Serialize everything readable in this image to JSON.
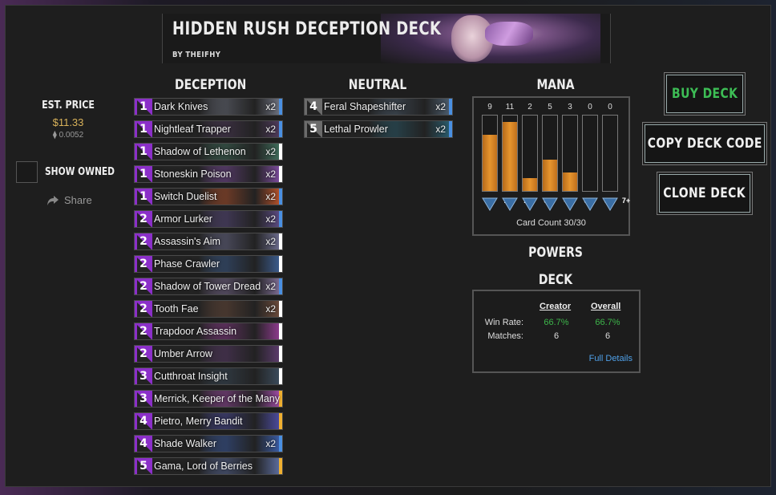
{
  "deck": {
    "title": "HIDDEN RUSH DECEPTION DECK",
    "author": "BY THEIFHY"
  },
  "columns": {
    "deception": "DECEPTION",
    "neutral": "NEUTRAL",
    "mana": "MANA",
    "powers": "POWERS",
    "deck_stats": "DECK STATS"
  },
  "price": {
    "label": "EST. PRICE",
    "usd": "$11.33",
    "eth": "⧫ 0.0052"
  },
  "owned": {
    "label": "SHOW OWNED"
  },
  "share": {
    "label": "Share"
  },
  "colors": {
    "deception_gem": "#8b2fc9",
    "neutral_gem": "#6b6b6b",
    "common_stripe": "#ffffff",
    "rare_stripe": "#4a90e2",
    "legendary_stripe": "#f0b030",
    "buy_text": "#3dbd55"
  },
  "deception_cards": [
    {
      "cost": "1",
      "name": "Dark Knives",
      "qty": "x2",
      "rarity": "rare",
      "art": "#6b6f7c"
    },
    {
      "cost": "1",
      "name": "Nightleaf Trapper",
      "qty": "x2",
      "rarity": "rare",
      "art": "#4e3a5a"
    },
    {
      "cost": "1",
      "name": "Shadow of Lethenon",
      "qty": "x2",
      "rarity": "common",
      "art": "#3f6b5a"
    },
    {
      "cost": "1",
      "name": "Stoneskin Poison",
      "qty": "x2",
      "rarity": "common",
      "art": "#7a4a9a"
    },
    {
      "cost": "1",
      "name": "Switch Duelist",
      "qty": "x2",
      "rarity": "rare",
      "art": "#b0502a"
    },
    {
      "cost": "2",
      "name": "Armor Lurker",
      "qty": "x2",
      "rarity": "rare",
      "art": "#5a4a80"
    },
    {
      "cost": "2",
      "name": "Assassin's Aim",
      "qty": "x2",
      "rarity": "common",
      "art": "#6a6a8a"
    },
    {
      "cost": "2",
      "name": "Phase Crawler",
      "qty": "",
      "rarity": "common",
      "art": "#3a5a8a"
    },
    {
      "cost": "2",
      "name": "Shadow of Tower Dread",
      "qty": "x2",
      "rarity": "rare",
      "art": "#7a6a90"
    },
    {
      "cost": "2",
      "name": "Tooth Fae",
      "qty": "x2",
      "rarity": "common",
      "art": "#6a4a3a"
    },
    {
      "cost": "2",
      "name": "Trapdoor Assassin",
      "qty": "",
      "rarity": "common",
      "art": "#8a3a8a"
    },
    {
      "cost": "2",
      "name": "Umber Arrow",
      "qty": "",
      "rarity": "common",
      "art": "#5a3a6a"
    },
    {
      "cost": "3",
      "name": "Cutthroat Insight",
      "qty": "",
      "rarity": "common",
      "art": "#3a4a5a"
    },
    {
      "cost": "3",
      "name": "Merrick, Keeper of the Many",
      "qty": "",
      "rarity": "legendary",
      "art": "#9a4aa0"
    },
    {
      "cost": "4",
      "name": "Pietro, Merry Bandit",
      "qty": "",
      "rarity": "legendary",
      "art": "#4a4a9a"
    },
    {
      "cost": "4",
      "name": "Shade Walker",
      "qty": "x2",
      "rarity": "rare",
      "art": "#3a5aa0"
    },
    {
      "cost": "5",
      "name": "Gama, Lord of Berries",
      "qty": "",
      "rarity": "legendary",
      "art": "#5a6a9a"
    }
  ],
  "neutral_cards": [
    {
      "cost": "4",
      "name": "Feral Shapeshifter",
      "qty": "x2",
      "rarity": "rare",
      "art": "#4a5a6a"
    },
    {
      "cost": "5",
      "name": "Lethal Prowler",
      "qty": "x2",
      "rarity": "rare",
      "art": "#2a5a6a"
    }
  ],
  "mana_curve": {
    "labels": [
      "1",
      "2",
      "3",
      "4",
      "5",
      "6",
      "7+"
    ],
    "counts": [
      9,
      11,
      2,
      5,
      3,
      0,
      0
    ],
    "max": 12,
    "card_count": "Card Count 30/30"
  },
  "stats": {
    "creator_header": "Creator",
    "overall_header": "Overall",
    "win_rate_label": "Win Rate:",
    "matches_label": "Matches:",
    "creator_win": "66.7%",
    "overall_win": "66.7%",
    "creator_matches": "6",
    "overall_matches": "6",
    "full_details": "Full Details"
  },
  "buttons": {
    "buy": "BUY DECK",
    "copy": "COPY DECK CODE",
    "clone": "CLONE DECK"
  }
}
